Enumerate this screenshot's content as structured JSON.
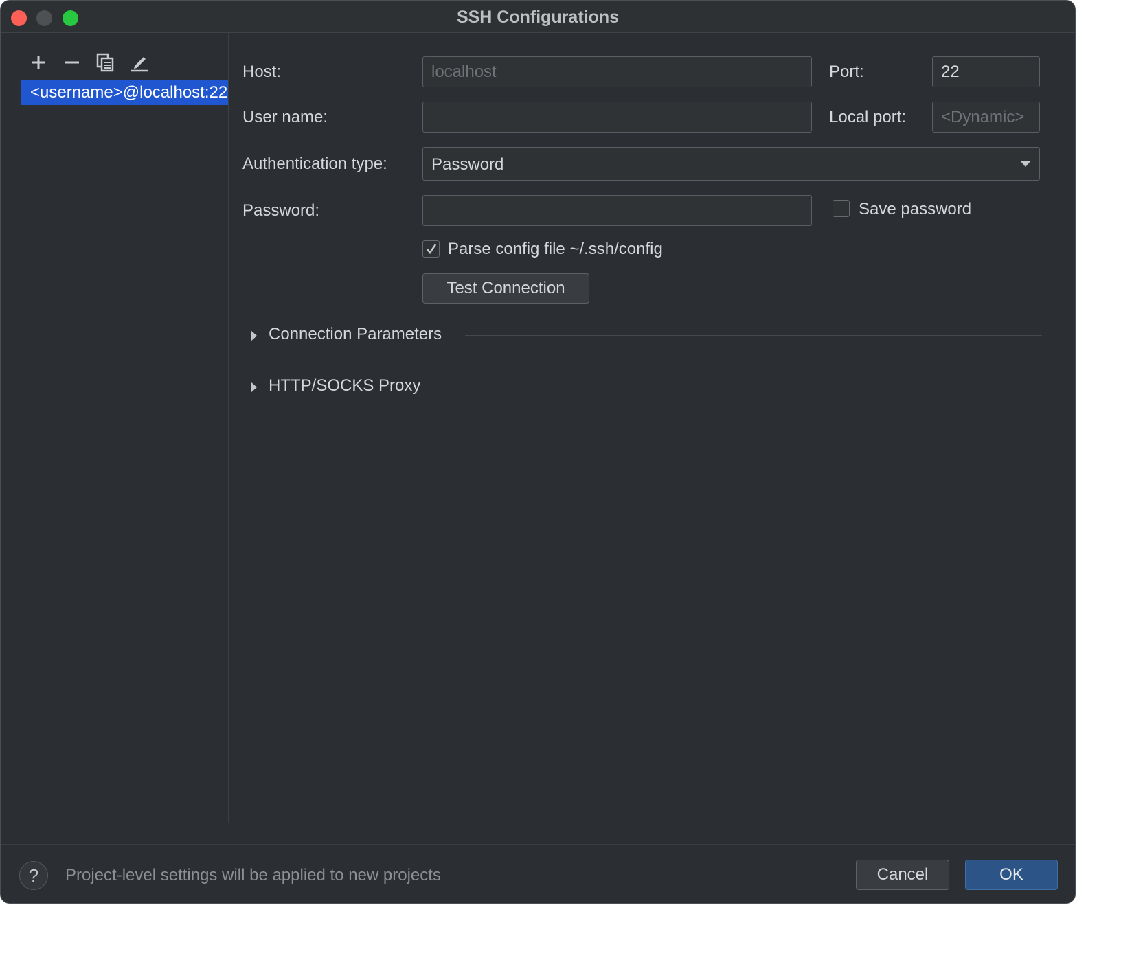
{
  "window": {
    "title": "SSH Configurations"
  },
  "toolbar": {
    "add_icon": "plus-icon",
    "remove_icon": "minus-icon",
    "copy_icon": "copy-icon",
    "edit_icon": "pencil-icon"
  },
  "config_list": {
    "items": [
      {
        "label": "<username>@localhost:22"
      }
    ]
  },
  "form": {
    "host_label": "Host:",
    "host_placeholder": "localhost",
    "port_label": "Port:",
    "port_value": "22",
    "username_label": "User name:",
    "username_value": "",
    "local_port_label": "Local port:",
    "local_port_placeholder": "<Dynamic>",
    "auth_type_label": "Authentication type:",
    "auth_type_value": "Password",
    "password_label": "Password:",
    "password_value": "",
    "save_password_label": "Save password",
    "save_password_checked": false,
    "parse_config_label": "Parse config file ~/.ssh/config",
    "parse_config_checked": true,
    "test_connection_label": "Test Connection"
  },
  "sections": [
    {
      "label": "Connection Parameters",
      "expanded": false
    },
    {
      "label": "HTTP/SOCKS Proxy",
      "expanded": false
    }
  ],
  "footer": {
    "help_label": "?",
    "info_text": "Project-level settings will be applied to new projects",
    "cancel_label": "Cancel",
    "ok_label": "OK"
  },
  "colors": {
    "background": "#2b2e32",
    "selection": "#2056d0",
    "ok_button": "#2c5486"
  }
}
